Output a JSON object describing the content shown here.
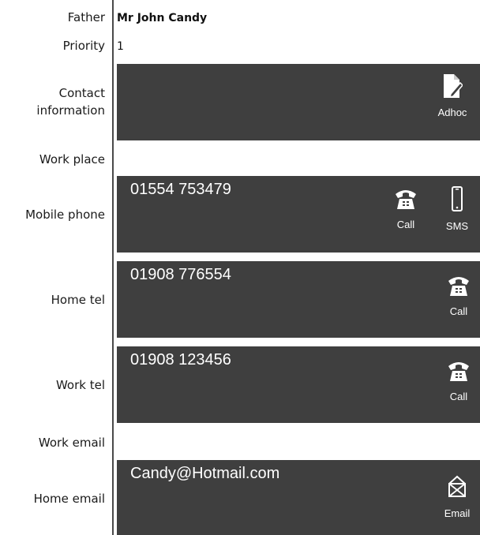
{
  "fields": {
    "father": {
      "label": "Father",
      "value": "Mr John Candy"
    },
    "priority": {
      "label": "Priority",
      "value": "1"
    },
    "contact_information": {
      "label_line1": "Contact",
      "label_line2": "information",
      "action": "Adhoc",
      "icon": "edit-document-icon"
    },
    "work_place": {
      "label": "Work place"
    },
    "mobile_phone": {
      "label": "Mobile phone",
      "value": "01554 753479",
      "actions": [
        "Call",
        "SMS"
      ],
      "icons": [
        "telephone-icon",
        "mobile-phone-icon"
      ]
    },
    "home_tel": {
      "label": "Home tel",
      "value": "01908 776554",
      "action": "Call",
      "icon": "telephone-icon"
    },
    "work_tel": {
      "label": "Work tel",
      "value": "01908 123456",
      "action": "Call",
      "icon": "telephone-icon"
    },
    "work_email": {
      "label": "Work email"
    },
    "home_email": {
      "label": "Home email",
      "value": "Candy@Hotmail.com",
      "action": "Email",
      "icon": "envelope-icon"
    }
  },
  "colors": {
    "panel": "#3f3f3f",
    "divider": "#4a4a4a",
    "background": "#ffffff"
  }
}
